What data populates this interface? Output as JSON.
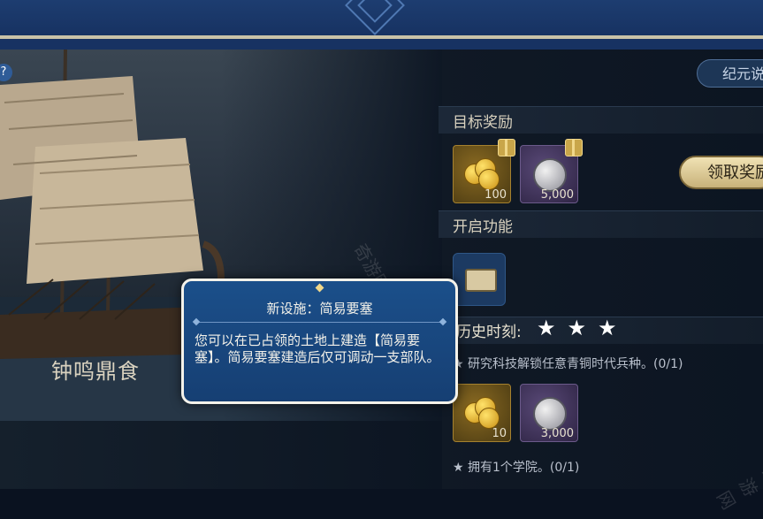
{
  "scene": {
    "title": "钟鸣鼎食"
  },
  "header": {
    "era_button_label": "纪元说"
  },
  "rewards": {
    "section_title": "目标奖励",
    "items": [
      {
        "icon": "gold-coins-icon",
        "quantity": "100"
      },
      {
        "icon": "silver-coins-icon",
        "quantity": "5,000"
      }
    ],
    "claim_label": "领取奖励"
  },
  "features": {
    "section_title": "开启功能",
    "items": [
      {
        "icon": "fortress-icon"
      }
    ]
  },
  "history": {
    "title": "历史时刻:",
    "stars": "★★★",
    "tasks": [
      {
        "label": "★ 研究科技解锁任意青铜时代兵种。(0/1)",
        "rewards": [
          {
            "icon": "gold-coins-icon",
            "quantity": "10"
          },
          {
            "icon": "silver-coins-icon",
            "quantity": "3,000"
          }
        ]
      },
      {
        "label": "★ 拥有1个学院。(0/1)"
      }
    ]
  },
  "popup": {
    "title": "新设施：简易要塞",
    "body": "您可以在已占领的土地上建造【简易要塞】。简易要塞建造后仅可调动一支部队。"
  },
  "watermark": {
    "text": "奇游网"
  },
  "help": {
    "label": "?"
  }
}
